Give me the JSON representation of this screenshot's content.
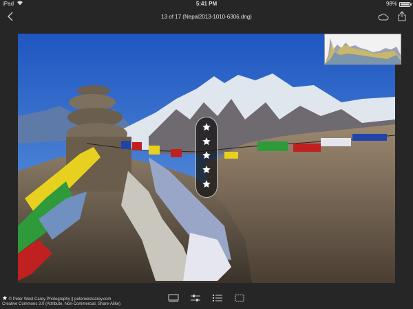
{
  "status_bar": {
    "device": "iPad",
    "time": "5:41 PM",
    "battery_percent": "98%",
    "battery_level": 0.98
  },
  "nav": {
    "title": "13 of 17 (Nepal2013-1010-6306.dng)"
  },
  "rating": {
    "stars": 5
  },
  "credit": {
    "line1": "© Peter West Carey Photography || peterwestcarey.com",
    "line2": "Creative Commons 3.0 (Attribute, Non-Commercial, Share-Alike)"
  },
  "toolbar": {
    "icons": [
      "filmstrip-icon",
      "adjust-sliders-icon",
      "list-icon",
      "crop-icon"
    ]
  },
  "colors": {
    "background": "#262626",
    "sky": "#2a63c6",
    "accent_text": "#e6e6e6"
  }
}
